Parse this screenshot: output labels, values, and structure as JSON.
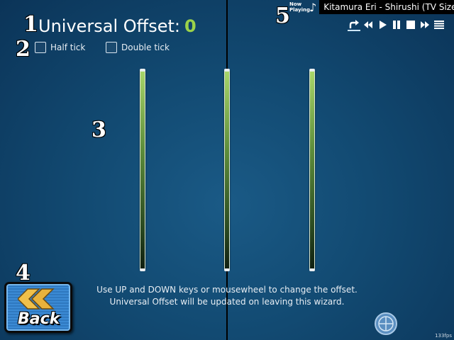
{
  "markers": {
    "one": "1",
    "two": "2",
    "three": "3",
    "four": "4",
    "five": "5"
  },
  "header": {
    "title": "Universal Offset:",
    "offset_value": "0"
  },
  "options": {
    "half_tick_label": "Half tick",
    "half_tick_checked": false,
    "double_tick_label": "Double tick",
    "double_tick_checked": false
  },
  "now_playing": {
    "label": "Now\nPlaying",
    "note_icon": "music-note-icon",
    "track": "Kitamura Eri - Shirushi (TV Size)"
  },
  "media_controls": [
    {
      "name": "repeat-icon",
      "active": true
    },
    {
      "name": "previous-icon"
    },
    {
      "name": "play-icon"
    },
    {
      "name": "pause-icon"
    },
    {
      "name": "stop-icon"
    },
    {
      "name": "next-icon"
    },
    {
      "name": "playlist-icon"
    }
  ],
  "instructions": {
    "line1": "Use UP and DOWN keys or mousewheel to change the offset.",
    "line2": "Universal Offset will be updated on leaving this wizard."
  },
  "back_button": {
    "label": "Back",
    "icon": "double-chevron-left-icon"
  },
  "globe_button": {
    "icon": "globe-icon"
  },
  "fps": "133fps",
  "colors": {
    "offset_value": "#9bd24a",
    "back_button": "#3b8ad4",
    "tick_bar": "#5d8d3b",
    "background": "#124a72"
  }
}
